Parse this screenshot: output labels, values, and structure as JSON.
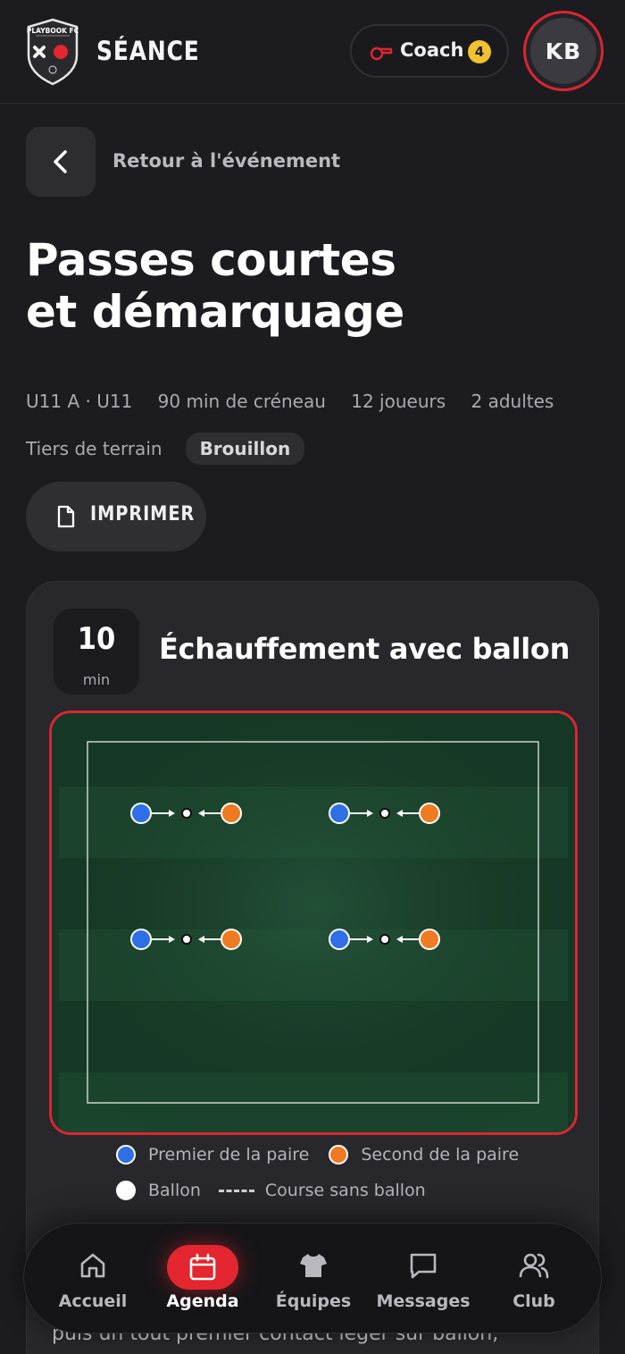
{
  "header": {
    "logo_text": "PLAYBOOK FC",
    "title": "SÉANCE",
    "coach_label": "Coach",
    "coach_count": "4",
    "avatar_initials": "KB"
  },
  "nav_back": {
    "label": "Retour à l'événement"
  },
  "session": {
    "title_line1": "Passes courtes",
    "title_line2": "et démarquage",
    "team": "U11 A · U11",
    "slot": "90 min de créneau",
    "players": "12 joueurs",
    "adults": "2 adultes",
    "field": "Tiers de terrain",
    "status": "Brouillon"
  },
  "actions": {
    "print_label": "IMPRIMER"
  },
  "block": {
    "duration": "10",
    "duration_unit": "min",
    "title": "Échauffement avec ballon",
    "legend": {
      "first": "Premier de la paire",
      "second": "Second de la paire",
      "ball": "Ballon",
      "run": "Course sans ballon"
    },
    "description_peek": "puis un tout premier contact léger sur ballon,"
  },
  "colors": {
    "accent": "#e3262f",
    "first_player": "#2f6fe6",
    "second_player": "#ee7b22",
    "badge": "#f2c12e"
  },
  "bottom_nav": {
    "items": [
      {
        "label": "Accueil",
        "icon": "home-icon"
      },
      {
        "label": "Agenda",
        "icon": "calendar-icon",
        "active": true
      },
      {
        "label": "Équipes",
        "icon": "jersey-icon"
      },
      {
        "label": "Messages",
        "icon": "chat-icon"
      },
      {
        "label": "Club",
        "icon": "users-icon"
      }
    ]
  }
}
